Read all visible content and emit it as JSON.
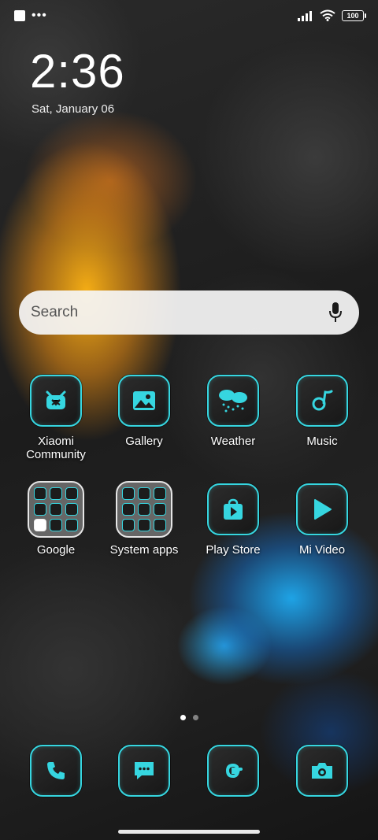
{
  "status_bar": {
    "battery": "100"
  },
  "lockclock": {
    "time": "2:36",
    "date": "Sat, January 06"
  },
  "search": {
    "placeholder": "Search"
  },
  "apps_row1": [
    {
      "label": "Xiaomi Community",
      "icon": "xiaomi-community-icon"
    },
    {
      "label": "Gallery",
      "icon": "gallery-icon"
    },
    {
      "label": "Weather",
      "icon": "weather-icon"
    },
    {
      "label": "Music",
      "icon": "music-icon"
    }
  ],
  "apps_row2": [
    {
      "label": "Google",
      "icon": "google-folder-icon"
    },
    {
      "label": "System apps",
      "icon": "system-apps-folder-icon"
    },
    {
      "label": "Play Store",
      "icon": "play-store-icon"
    },
    {
      "label": "Mi Video",
      "icon": "mi-video-icon"
    }
  ],
  "dock": [
    {
      "icon": "phone-icon"
    },
    {
      "icon": "messages-icon"
    },
    {
      "icon": "google-icon"
    },
    {
      "icon": "camera-icon"
    }
  ],
  "colors": {
    "accent": "#36d6e0",
    "icon_bg": "#1c1c1c"
  }
}
